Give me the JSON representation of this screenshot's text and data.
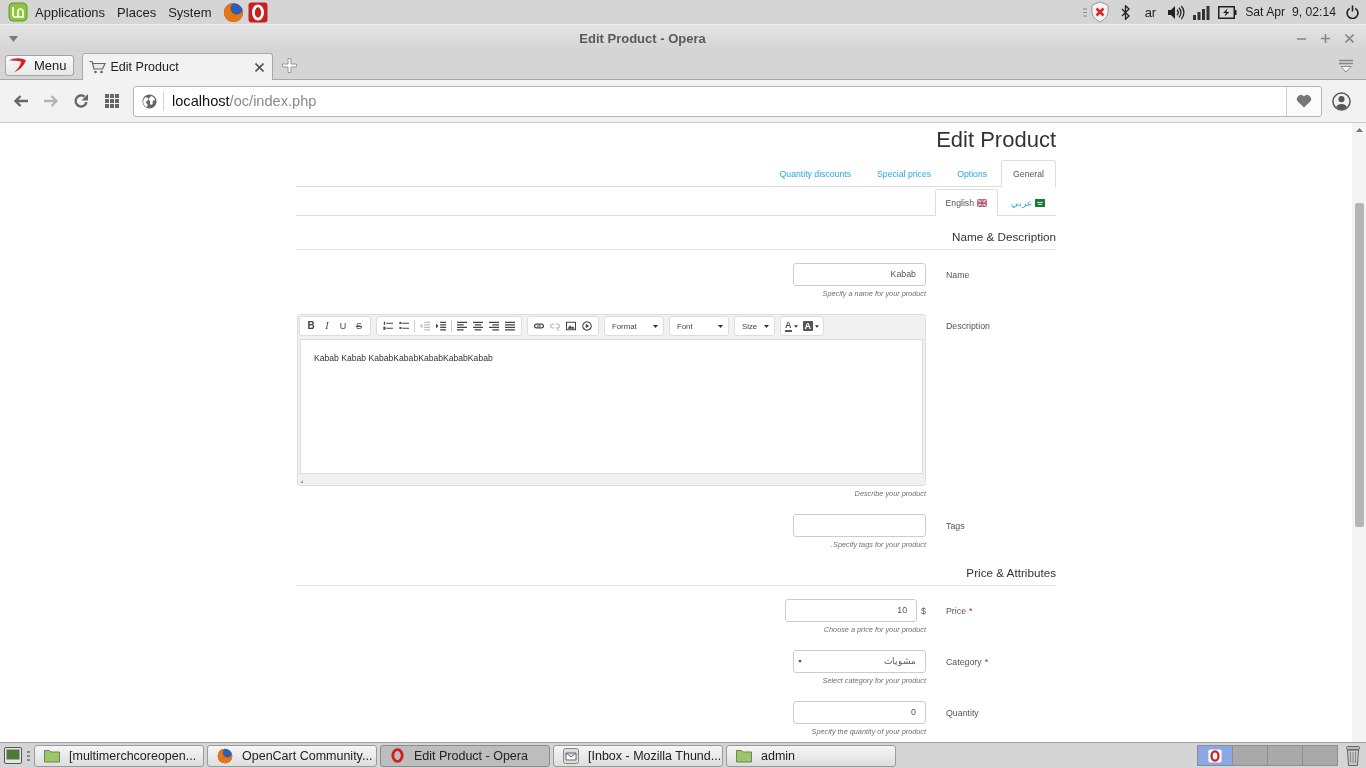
{
  "panel": {
    "menus": [
      "Applications",
      "Places",
      "System"
    ],
    "keyboard_layout": "ar",
    "clock": "Sat Apr  9, 02:14"
  },
  "window": {
    "title": "Edit Product - Opera"
  },
  "browser": {
    "menu_label": "Menu",
    "tabs": [
      {
        "title": "Edit Product",
        "selected": true
      }
    ],
    "back": {
      "disabled": false
    },
    "forward": {
      "disabled": true
    },
    "address": {
      "host": "localhost",
      "path": "/oc/index.php"
    }
  },
  "page": {
    "title": "Edit Product",
    "tabs": [
      {
        "label": "Quantity discounts",
        "selected": false
      },
      {
        "label": "Special prices",
        "selected": false
      },
      {
        "label": "Options",
        "selected": false
      },
      {
        "label": "General",
        "selected": true
      }
    ],
    "languages": [
      {
        "label": "English",
        "selected": true
      },
      {
        "label": "عربي",
        "selected": false
      }
    ],
    "sections": [
      {
        "title": "Name & Description",
        "fields": [
          {
            "kind": "text",
            "label": "Name",
            "value": "Kabab",
            "hint": "Specify a name for your product"
          },
          {
            "kind": "editor",
            "label": "Description",
            "hint": "Describe your product",
            "toolbar": {
              "text_buttons": [
                "B",
                "I",
                "U",
                "S"
              ],
              "paragraph_buttons": [
                {
                  "disabled": false
                },
                {
                  "disabled": false
                },
                {
                  "disabled": true
                },
                {
                  "disabled": false
                },
                {
                  "disabled": false
                },
                {
                  "disabled": false
                },
                {
                  "disabled": false
                },
                {
                  "disabled": false
                }
              ],
              "insert_buttons": [
                {
                  "disabled": false
                },
                {
                  "disabled": true
                },
                {
                  "disabled": false
                },
                {
                  "disabled": false
                }
              ],
              "dropdowns": [
                "Format",
                "Font",
                "Size"
              ],
              "color_buttons": [
                "A",
                "A"
              ]
            },
            "content": "Kabab Kabab KababKababKababKababKabab"
          },
          {
            "kind": "text",
            "label": "Tags",
            "hint": ".Specify tags for your product"
          }
        ]
      },
      {
        "title": "Price & Attributes",
        "fields": [
          {
            "kind": "price",
            "label": "Price",
            "required_mark": "*",
            "value": "10",
            "currency": "$",
            "hint": "Choose a price for your product"
          },
          {
            "kind": "select",
            "label": "Category",
            "required_mark": "*",
            "value": "مشويات",
            "hint": "Select category for your product"
          },
          {
            "kind": "text",
            "label": "Quantity",
            "value": "0",
            "hint": "Specify the quantity of your product"
          }
        ]
      }
    ]
  },
  "taskbar": {
    "windows": [
      {
        "label": "[multimerchcoreopen...",
        "selected": false
      },
      {
        "label": "OpenCart Community...",
        "selected": false
      },
      {
        "label": "Edit Product - Opera",
        "selected": true
      },
      {
        "label": "[Inbox - Mozilla Thund...",
        "selected": false
      },
      {
        "label": "admin",
        "selected": false
      }
    ],
    "workspaces": [
      {
        "selected": true
      },
      {
        "selected": false
      },
      {
        "selected": false
      },
      {
        "selected": false
      }
    ]
  }
}
